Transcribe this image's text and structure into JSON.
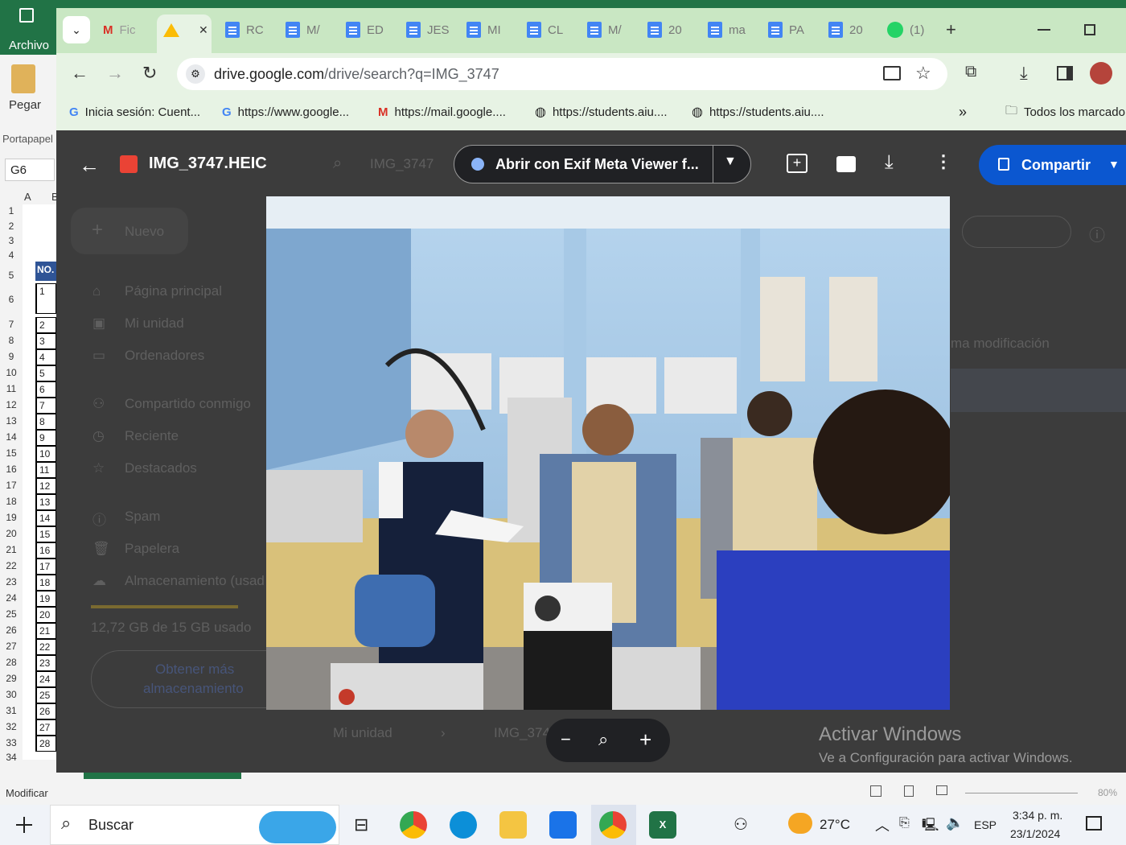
{
  "excel": {
    "file_label": "Archivo",
    "paste_label": "Pegar",
    "clipboard_label": "Portapapel",
    "name_box": "G6",
    "col_a": "A",
    "col_b": "B",
    "header_cell": "NO.",
    "row_headers": [
      "1",
      "2",
      "3",
      "4",
      "5",
      "6",
      "7",
      "8",
      "9",
      "10",
      "11",
      "12",
      "13",
      "14",
      "15",
      "16",
      "17",
      "18",
      "19",
      "20",
      "21",
      "22",
      "23",
      "24",
      "25",
      "26",
      "27",
      "28",
      "29",
      "30",
      "31",
      "32",
      "33",
      "34"
    ],
    "cell_values": [
      "1",
      "2",
      "3",
      "4",
      "5",
      "6",
      "7",
      "8",
      "9",
      "10",
      "11",
      "12",
      "13",
      "14",
      "15",
      "16",
      "17",
      "18",
      "19",
      "20",
      "21",
      "22",
      "23",
      "24",
      "25",
      "26",
      "27",
      "28"
    ],
    "status_mode": "Modificar",
    "zoom": "80%"
  },
  "browser": {
    "tabs": [
      {
        "label": "Fic",
        "icon": "gmail-icon"
      },
      {
        "label": "",
        "icon": "drive-icon"
      },
      {
        "label": "RC",
        "icon": "docs-icon"
      },
      {
        "label": "M/",
        "icon": "docs-icon"
      },
      {
        "label": "ED",
        "icon": "docs-icon"
      },
      {
        "label": "JES",
        "icon": "docs-icon"
      },
      {
        "label": "MI",
        "icon": "docs-icon"
      },
      {
        "label": "CL",
        "icon": "docs-icon"
      },
      {
        "label": "M/",
        "icon": "docs-icon"
      },
      {
        "label": "20",
        "icon": "docs-icon"
      },
      {
        "label": "ma",
        "icon": "docs-icon"
      },
      {
        "label": "PA",
        "icon": "docs-icon"
      },
      {
        "label": "20",
        "icon": "docs-icon"
      },
      {
        "label": "(1)",
        "icon": "whatsapp-icon"
      }
    ],
    "url_host": "drive.google.com",
    "url_path": "/drive/search?q=IMG_3747",
    "bookmarks": [
      "Inicia sesión: Cuent...",
      "https://www.google...",
      "https://mail.google....",
      "https://students.aiu....",
      "https://students.aiu...."
    ],
    "all_bookmarks": "Todos los marcado"
  },
  "viewer": {
    "file_name": "IMG_3747.HEIC",
    "open_with": "Abrir con Exif Meta Viewer f...",
    "share_label": "Compartir"
  },
  "drive_bg": {
    "search_text": "IMG_3747",
    "new_label": "Nuevo",
    "nav": [
      "Página principal",
      "Mi unidad",
      "Ordenadores",
      "Compartido conmigo",
      "Reciente",
      "Destacados",
      "Spam",
      "Papelera",
      "Almacenamiento (usad"
    ],
    "storage": "12,72 GB de 15 GB usado",
    "get_storage_1": "Obtener más",
    "get_storage_2": "almacenamiento",
    "column_modified": "ma modificación",
    "breadcrumb_1": "Mi unidad",
    "breadcrumb_2": "IMG_374"
  },
  "watermark": {
    "title": "Activar Windows",
    "subtitle": "Ve a Configuración para activar Windows."
  },
  "taskbar": {
    "search": "Buscar",
    "temp": "27°C",
    "lang": "ESP",
    "time": "3:34 p. m.",
    "date": "23/1/2024"
  },
  "colors": {
    "share_btn": "#0b57d0",
    "excel_green": "#217346",
    "chrome_tab": "#c9e7c3"
  }
}
